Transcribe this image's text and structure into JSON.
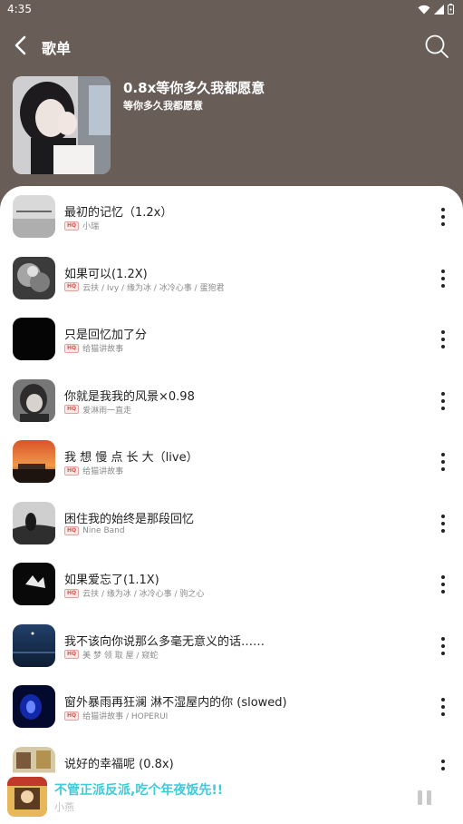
{
  "status_bar": {
    "time": "4:35"
  },
  "header": {
    "title": "歌单"
  },
  "playlist": {
    "title": "0.8x等你多久我都愿意",
    "subtitle": "等你多久我都愿意"
  },
  "quality_badge": "HQ",
  "songs": [
    {
      "title": "最初的记忆（1.2x）",
      "artist": "小瑞"
    },
    {
      "title": "如果可以(1.2X)",
      "artist": "云扶 / Ivy / 缘为冰 / 冰冷心事 / 蛋狍君"
    },
    {
      "title": "只是回忆加了分",
      "artist": "给猫讲故事"
    },
    {
      "title": "你就是我我的风景×0.98",
      "artist": "爱淋雨一直走"
    },
    {
      "title": "我 想 慢 点 长 大（live）",
      "artist": "给猫讲故事"
    },
    {
      "title": "困住我的始终是那段回忆",
      "artist": "Nine Band"
    },
    {
      "title": "如果爱忘了(1.1X)",
      "artist": "云扶 / 缘为冰 / 冰冷心事 / 驹之心"
    },
    {
      "title": "我不该向你说那么多毫无意义的话……",
      "artist": "美 梦 领 取 屋 / 窥蛇"
    },
    {
      "title": "窗外暴雨再狂澜 淋不湿屋内的你 (slowed)",
      "artist": "给猫讲故事 / HOPERUI"
    },
    {
      "title": "说好的幸福呢 (0.8x)",
      "artist": ""
    }
  ],
  "now_playing": {
    "title": "不管正派反派,吃个年夜饭先!!",
    "artist": "小燕"
  },
  "colors": {
    "header_bg": "#695d58",
    "accent": "#3ccbd8",
    "hq": "#d35a52"
  }
}
